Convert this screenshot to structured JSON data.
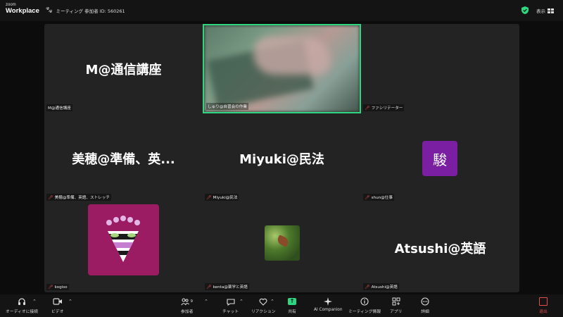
{
  "app": {
    "logo_top": "zoom",
    "logo_bottom": "Workplace"
  },
  "meeting": {
    "title": "ミーティング 参加者 ID: 560261"
  },
  "view_label": "表示",
  "tiles": [
    {
      "big": "M@通信講座",
      "label": "M@通信講座",
      "muted": false
    },
    {
      "big": "",
      "label": "しゅり@自習会の作業",
      "muted": false
    },
    {
      "big": "",
      "label": "ファシリテーター",
      "muted": true
    },
    {
      "big": "美穂@準備、英...",
      "label": "美穂@準備、英語、ストレッチ",
      "muted": true
    },
    {
      "big": "Miyuki@民法",
      "label": "Miyuki@民法",
      "muted": true
    },
    {
      "big": "",
      "label": "shun@仕事",
      "muted": true
    },
    {
      "big": "",
      "label": "kogiso",
      "muted": true
    },
    {
      "big": "",
      "label": "kenta@薬学と英語",
      "muted": true
    },
    {
      "big": "Atsushi@英語",
      "label": "Atsushi@英語",
      "muted": true
    }
  ],
  "avatars": {
    "shun_char": "駿"
  },
  "controls": {
    "audio": "オーディオに接続",
    "video": "ビデオ",
    "participants": "参加者",
    "participants_count": "9",
    "chat": "チャット",
    "reactions": "リアクション",
    "share": "共有",
    "ai": "AI Companion",
    "info": "ミーティング情報",
    "apps": "アプリ",
    "more": "詳細",
    "leave": "退出"
  },
  "colors": {
    "accent_green": "#2dd67f",
    "leave_red": "#e84c4c",
    "avatar_purple": "#7a1fa2",
    "avatar_magenta": "#9b1c63"
  }
}
